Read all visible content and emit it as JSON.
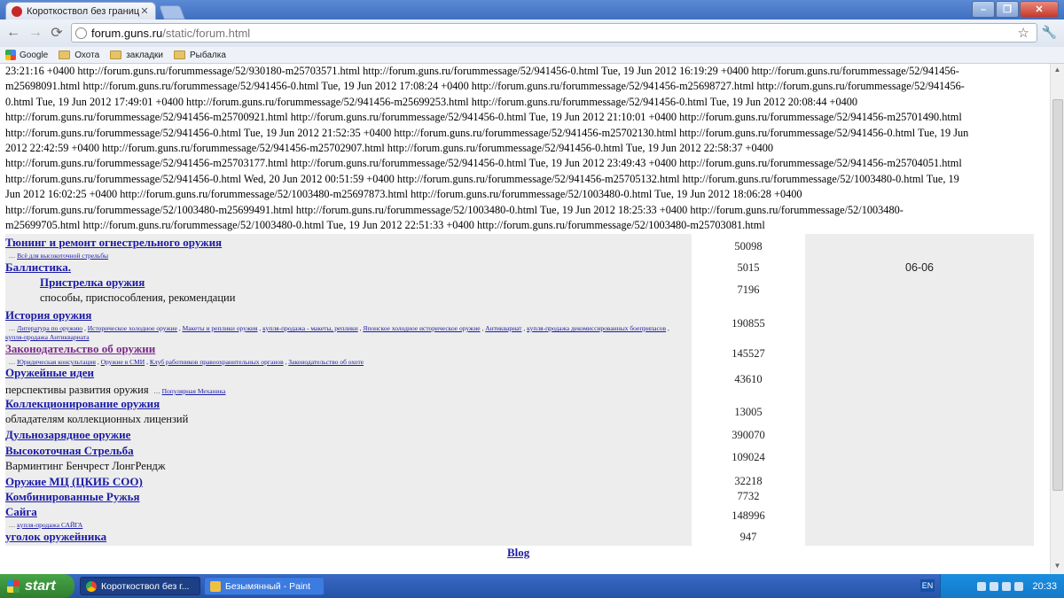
{
  "browser": {
    "tab_title": "Короткоствол без границ : Gi",
    "url_host": "forum.guns.ru",
    "url_path": "/static/forum.html",
    "bookmarks": [
      "Google",
      "Охота",
      "закладки",
      "Рыбалка"
    ]
  },
  "log_lines": [
    "23:21:16 +0400 http://forum.guns.ru/forummessage/52/930180-m25703571.html http://forum.guns.ru/forummessage/52/941456-0.html Tue, 19 Jun 2012 16:19:29 +0400 http://forum.guns.ru/forummessage/52/941456-",
    "m25698091.html http://forum.guns.ru/forummessage/52/941456-0.html Tue, 19 Jun 2012 17:08:24 +0400 http://forum.guns.ru/forummessage/52/941456-m25698727.html http://forum.guns.ru/forummessage/52/941456-",
    "0.html Tue, 19 Jun 2012 17:49:01 +0400 http://forum.guns.ru/forummessage/52/941456-m25699253.html http://forum.guns.ru/forummessage/52/941456-0.html Tue, 19 Jun 2012 20:08:44 +0400",
    "http://forum.guns.ru/forummessage/52/941456-m25700921.html http://forum.guns.ru/forummessage/52/941456-0.html Tue, 19 Jun 2012 21:10:01 +0400 http://forum.guns.ru/forummessage/52/941456-m25701490.html",
    "http://forum.guns.ru/forummessage/52/941456-0.html Tue, 19 Jun 2012 21:52:35 +0400 http://forum.guns.ru/forummessage/52/941456-m25702130.html http://forum.guns.ru/forummessage/52/941456-0.html Tue, 19 Jun",
    "2012 22:42:59 +0400 http://forum.guns.ru/forummessage/52/941456-m25702907.html http://forum.guns.ru/forummessage/52/941456-0.html Tue, 19 Jun 2012 22:58:37 +0400",
    "http://forum.guns.ru/forummessage/52/941456-m25703177.html http://forum.guns.ru/forummessage/52/941456-0.html Tue, 19 Jun 2012 23:49:43 +0400 http://forum.guns.ru/forummessage/52/941456-m25704051.html",
    "http://forum.guns.ru/forummessage/52/941456-0.html Wed, 20 Jun 2012 00:51:59 +0400 http://forum.guns.ru/forummessage/52/941456-m25705132.html http://forum.guns.ru/forummessage/52/1003480-0.html Tue, 19",
    "Jun 2012 16:02:25 +0400 http://forum.guns.ru/forummessage/52/1003480-m25697873.html http://forum.guns.ru/forummessage/52/1003480-0.html Tue, 19 Jun 2012 18:06:28 +0400",
    "http://forum.guns.ru/forummessage/52/1003480-m25699491.html http://forum.guns.ru/forummessage/52/1003480-0.html Tue, 19 Jun 2012 18:25:33 +0400 http://forum.guns.ru/forummessage/52/1003480-",
    "m25699705.html http://forum.guns.ru/forummessage/52/1003480-0.html Tue, 19 Jun 2012 22:51:33 +0400 http://forum.guns.ru/forummessage/52/1003480-m25703081.html"
  ],
  "forums": [
    {
      "title": "Тюнинг и ремонт огнестрельного оружия",
      "sub": [
        "Всё для высокоточной стрельбы"
      ],
      "desc": "",
      "count": "50098",
      "date": ""
    },
    {
      "title": "Баллистика.",
      "sub": [],
      "desc": "",
      "count": "5015",
      "date": "06-06"
    },
    {
      "title": "Пристрелка оружия",
      "sub": [],
      "desc": "способы, приспособления, рекомендации",
      "count": "7196",
      "date": ""
    },
    {
      "title": "История оружия",
      "sub": [
        "Литература по оружию",
        "Историческое холодное оружие",
        "Макеты и реплики оружия",
        "купля-продажа - макеты, реплики",
        "Японское холодное историческое оружие",
        "Антиквариат",
        "купля-продажа декомиссированных боеприпасов",
        "купля-продажа Антиквариата"
      ],
      "desc": "",
      "count": "190855",
      "date": ""
    },
    {
      "title": "Законодательство об оружии",
      "sub": [
        "Юридическая консультация",
        "Оружие в СМИ",
        "Клуб работников правоохранительных органов",
        "Законодательство об охоте"
      ],
      "desc": "",
      "count": "145527",
      "date": ""
    },
    {
      "title": "Оружейные идеи",
      "sub": [
        "Популярная Механика"
      ],
      "desc": "перспективы развития оружия",
      "count": "43610",
      "date": ""
    },
    {
      "title": "Коллекционирование оружия",
      "sub": [],
      "desc": "обладателям коллекционных лицензий",
      "count": "13005",
      "date": ""
    },
    {
      "title": "Дульнозарядное оружие",
      "sub": [],
      "desc": "",
      "count": "390070",
      "date": ""
    },
    {
      "title": "Высокоточная Стрельба",
      "sub": [],
      "desc": "Варминтинг Бенчрест ЛонгРендж",
      "count": "109024",
      "date": ""
    },
    {
      "title": "Оружие МЦ (ЦКИБ СОО)",
      "sub": [],
      "desc": "",
      "count": "32218",
      "date": ""
    },
    {
      "title": "Комбинированные Ружья",
      "sub": [],
      "desc": "",
      "count": "7732",
      "date": ""
    },
    {
      "title": "Сайга",
      "sub": [
        "купля-продажа САЙГА"
      ],
      "desc": "",
      "count": "148996",
      "date": ""
    },
    {
      "title": "уголок оружейника",
      "sub": [],
      "desc": "",
      "count": "947",
      "date": ""
    }
  ],
  "footer_link": "Blog",
  "taskbar": {
    "start_label": "start",
    "items": [
      "Короткоствол без г...",
      "Безымянный - Paint"
    ],
    "lang": "EN",
    "clock": "20:33"
  }
}
